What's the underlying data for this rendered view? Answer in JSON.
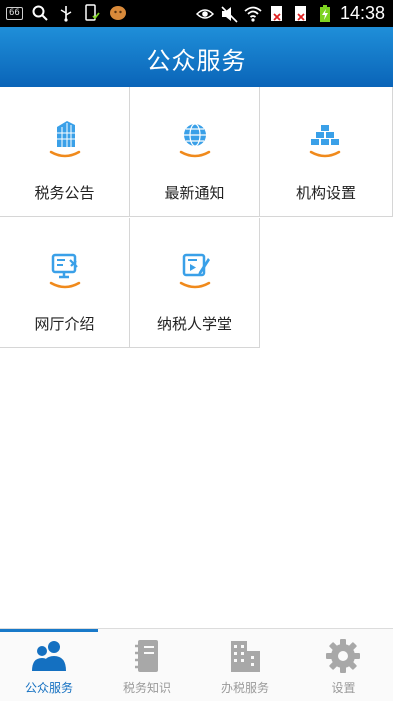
{
  "status_bar": {
    "notification_badge": "66",
    "time": "14:38",
    "icons": [
      "search-icon",
      "usb-icon",
      "phone-check-icon",
      "app-icon",
      "eye-icon",
      "mute-icon",
      "wifi-icon",
      "sim-no-signal-icon",
      "sim-no-signal-icon",
      "battery-charging-icon"
    ]
  },
  "header": {
    "title": "公众服务"
  },
  "grid": {
    "items": [
      {
        "label": "税务公告",
        "icon": "building-icon"
      },
      {
        "label": "最新通知",
        "icon": "globe-icon"
      },
      {
        "label": "机构设置",
        "icon": "brick-wall-icon"
      },
      {
        "label": "网厅介绍",
        "icon": "monitor-tools-icon"
      },
      {
        "label": "纳税人学堂",
        "icon": "video-edit-icon"
      }
    ]
  },
  "tabbar": {
    "tabs": [
      {
        "label": "公众服务",
        "icon": "people-icon",
        "active": true
      },
      {
        "label": "税务知识",
        "icon": "notebook-icon",
        "active": false
      },
      {
        "label": "办税服务",
        "icon": "office-building-icon",
        "active": false
      },
      {
        "label": "设置",
        "icon": "gear-icon",
        "active": false
      }
    ]
  },
  "colors": {
    "header": "#1275c8",
    "icon_blue": "#3aa0e8",
    "icon_orange": "#f08a1c",
    "tab_active": "#1470c1",
    "tab_inactive": "#9a9a9a"
  }
}
